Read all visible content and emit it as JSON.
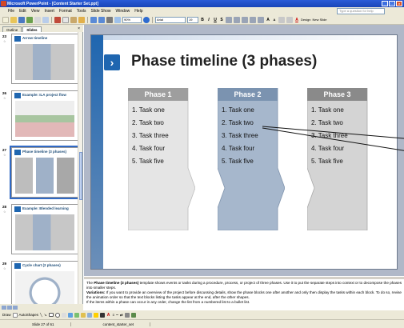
{
  "window": {
    "title": "Microsoft PowerPoint - [Content Starter Set.ppt]"
  },
  "menu": [
    "File",
    "Edit",
    "View",
    "Insert",
    "Format",
    "Tools",
    "Slide Show",
    "Window",
    "Help"
  ],
  "help_placeholder": "Type a question for help",
  "toolbar": {
    "zoom": "90%",
    "font": "Arial",
    "font_size": "19",
    "design_label": "Design",
    "new_slide_label": "New Slide"
  },
  "pane_tabs": [
    "Outline",
    "Slides"
  ],
  "thumbnails": [
    {
      "num": "23",
      "title": "Arrow timeline"
    },
    {
      "num": "26",
      "title": "Example: ILA project flow"
    },
    {
      "num": "27",
      "title": "Phase timeline (3 phases)"
    },
    {
      "num": "28",
      "title": "Example: Blended learning"
    },
    {
      "num": "29",
      "title": "Cycle chart (2 phases)"
    }
  ],
  "slide": {
    "title": "Phase timeline (3 phases)",
    "phases": [
      {
        "label": "Phase 1",
        "tasks": [
          "1. Task one",
          "2. Task two",
          "3. Task three",
          "4. Task four",
          "5. Task five"
        ]
      },
      {
        "label": "Phase 2",
        "tasks": [
          "1. Task one",
          "2. Task two",
          "3. Task three",
          "4. Task four",
          "5. Task five"
        ]
      },
      {
        "label": "Phase 3",
        "tasks": [
          "1. Task one",
          "2. Task two",
          "3. Task three",
          "4. Task four",
          "5. Task five"
        ]
      }
    ]
  },
  "notes": {
    "line1_pre": "The ",
    "line1_bold": "Phase timeline (3 phases)",
    "line1_post": " template shows events or tasks during a procedure, process, or project of three phases. Use it to put the separate steps into context or to decompose the phases into smaller steps.",
    "line2_bold": "Variations:",
    "line2_post": " If you want to provide an overview of the project before discussing details, show the phase blocks one after another and only then display the tasks within each block. To do so, revise the animation order so that the text blocks listing the tasks appear at the end, after the other shapes.",
    "line3": "If the items within a phase can occur in any order, change the list from a numbered list to a bullet list."
  },
  "drawbar": {
    "draw_label": "Draw",
    "autoshapes_label": "AutoShapes"
  },
  "status": {
    "slide": "Slide 27 of 61",
    "design": "content_starter_set"
  },
  "colors": {
    "phase1": "#9e9e9e",
    "phase2": "#7b93b0",
    "phase3": "#8a8a8a",
    "accent": "#1f66b0"
  }
}
